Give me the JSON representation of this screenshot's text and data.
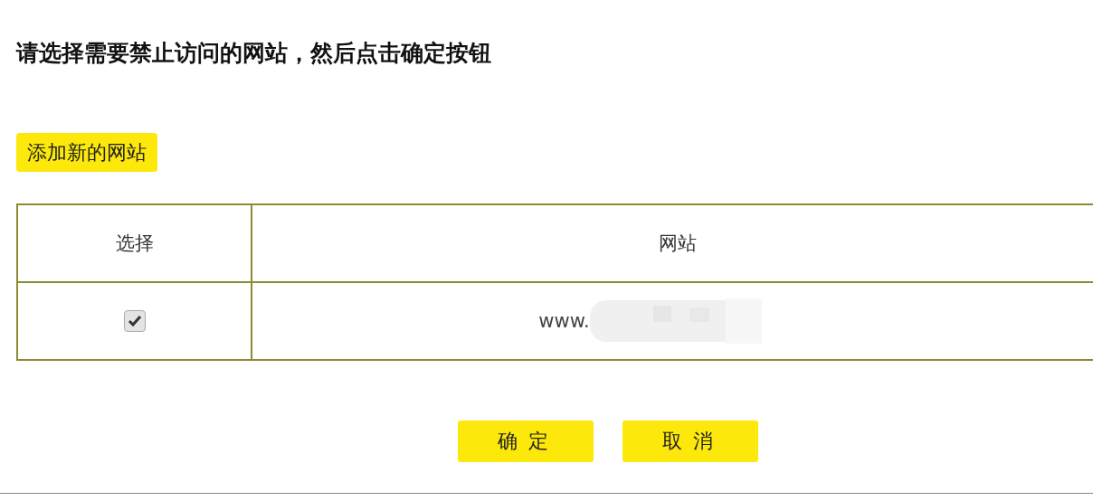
{
  "heading": "请选择需要禁止访问的网站，然后点击确定按钮",
  "add_button": "添加新的网站",
  "table": {
    "columns": [
      "选择",
      "网站"
    ],
    "rows": [
      {
        "checked": true,
        "website": "www."
      }
    ]
  },
  "buttons": [
    "确定",
    "取消"
  ]
}
